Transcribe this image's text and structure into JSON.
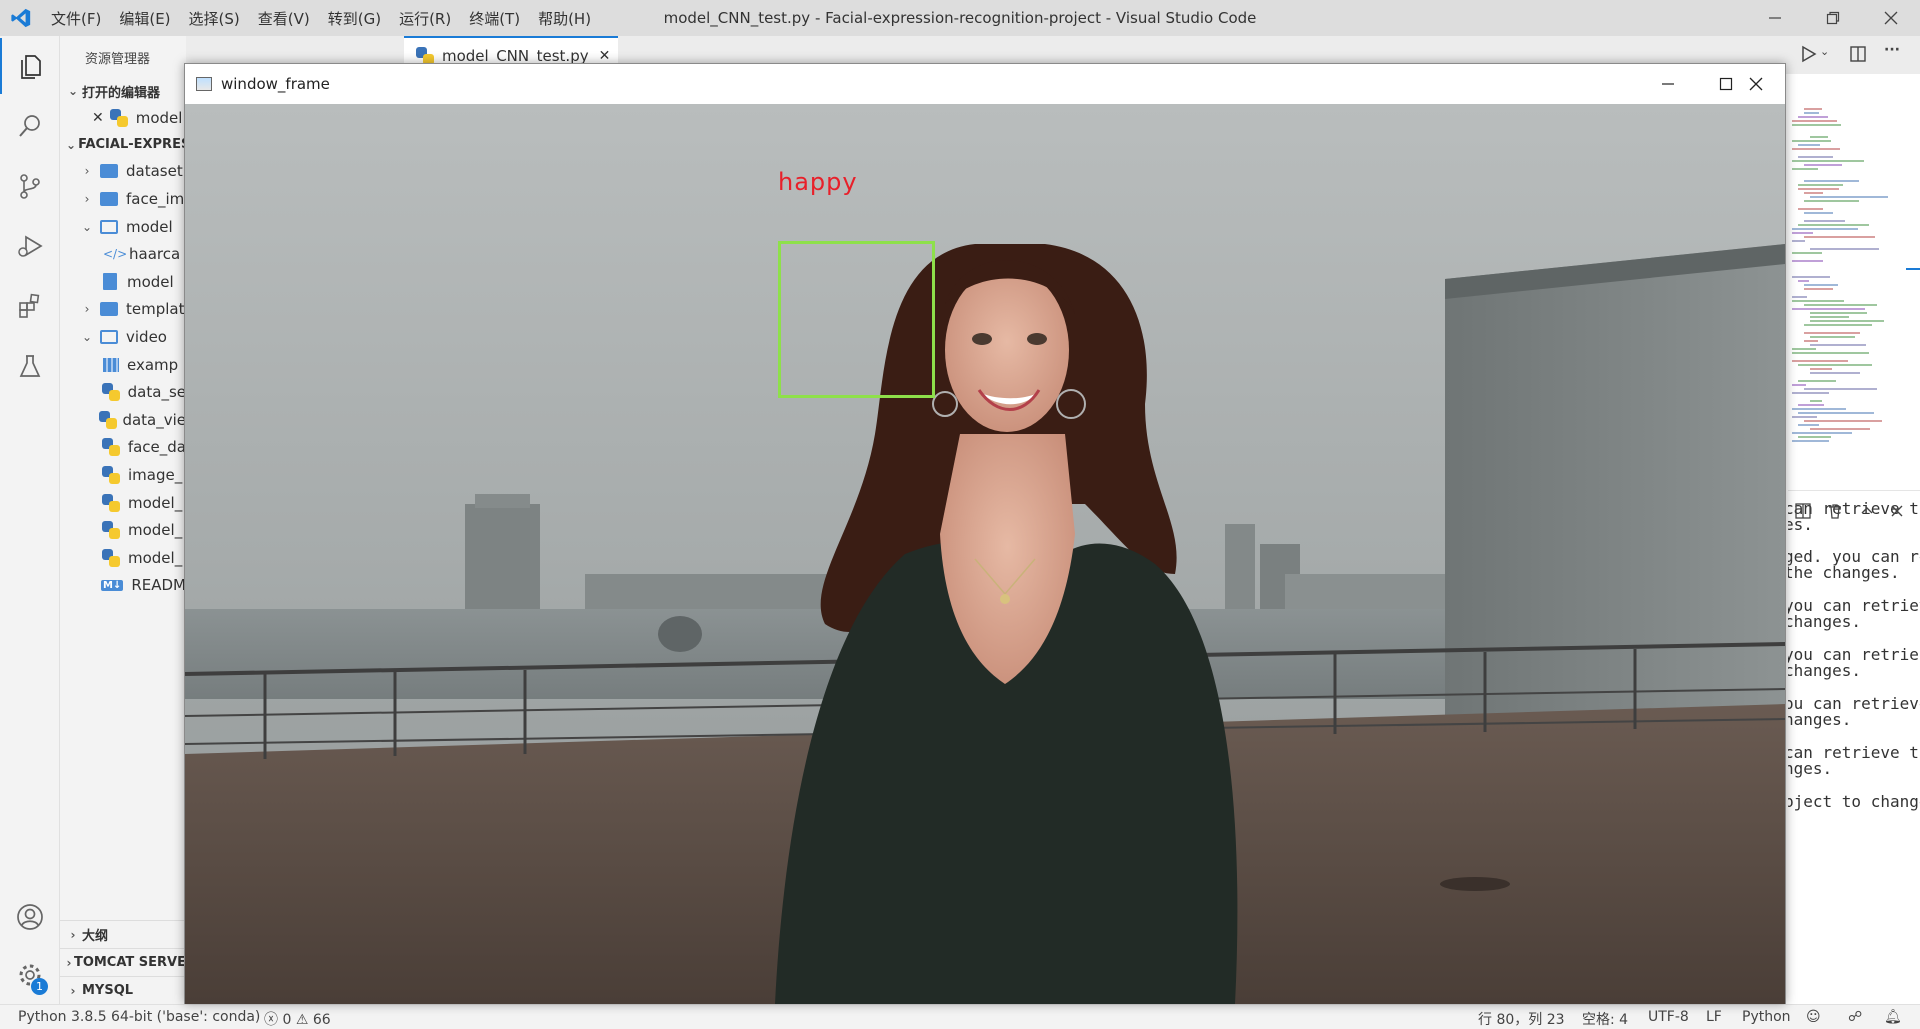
{
  "window": {
    "title": "model_CNN_test.py - Facial-expression-recognition-project - Visual Studio Code",
    "menu": [
      "文件(F)",
      "编辑(E)",
      "选择(S)",
      "查看(V)",
      "转到(G)",
      "运行(R)",
      "终端(T)",
      "帮助(H)"
    ]
  },
  "sidebar": {
    "header": "资源管理器",
    "more": "···",
    "open_editors_label": "打开的编辑器",
    "open_editor_item": "model",
    "project_label": "FACIAL-EXPRES",
    "tree": [
      {
        "label": "dataset",
        "kind": "folder",
        "expanded": false
      },
      {
        "label": "face_im",
        "kind": "folder",
        "expanded": false
      },
      {
        "label": "model",
        "kind": "folder",
        "expanded": true
      },
      {
        "label": "haarca",
        "kind": "xml"
      },
      {
        "label": "model",
        "kind": "file"
      },
      {
        "label": "templat",
        "kind": "folder",
        "expanded": false
      },
      {
        "label": "video",
        "kind": "folder",
        "expanded": true
      },
      {
        "label": "examp",
        "kind": "video"
      },
      {
        "label": "data_se",
        "kind": "python"
      },
      {
        "label": "data_vie",
        "kind": "python"
      },
      {
        "label": "face_da",
        "kind": "python"
      },
      {
        "label": "image_",
        "kind": "python"
      },
      {
        "label": "model_",
        "kind": "python"
      },
      {
        "label": "model_",
        "kind": "python"
      },
      {
        "label": "model_",
        "kind": "python"
      },
      {
        "label": "READM",
        "kind": "markdown"
      }
    ],
    "bottom_sections": [
      "大纲",
      "TOMCAT SERVE",
      "MYSQL"
    ]
  },
  "editor": {
    "active_tab": "model_CNN_test.py"
  },
  "accounts_badge": "1",
  "terminal": {
    "lines": [
      "can retrieve the",
      "es.",
      "ged. you can re",
      "the changes.",
      "you can retriev",
      "changes.",
      "you can retrie",
      "changes.",
      "ou can retrieve",
      "hanges.",
      "can retrieve t",
      "nges.",
      "bject to change"
    ]
  },
  "statusbar": {
    "interpreter": "Python 3.8.5 64-bit ('base': conda)",
    "errors": "0",
    "warnings": "66",
    "cursor": "行 80，列 23",
    "spaces": "空格: 4",
    "encoding": "UTF-8",
    "eol": "LF",
    "language": "Python"
  },
  "cv_window": {
    "title": "window_frame",
    "label": "happy",
    "label_color": "#e8202a",
    "box_color": "#8ee04a"
  },
  "colors": {
    "accent": "#1a7bd6",
    "titlebar": "#dddddd",
    "activity_bar": "#f3f3f3"
  }
}
